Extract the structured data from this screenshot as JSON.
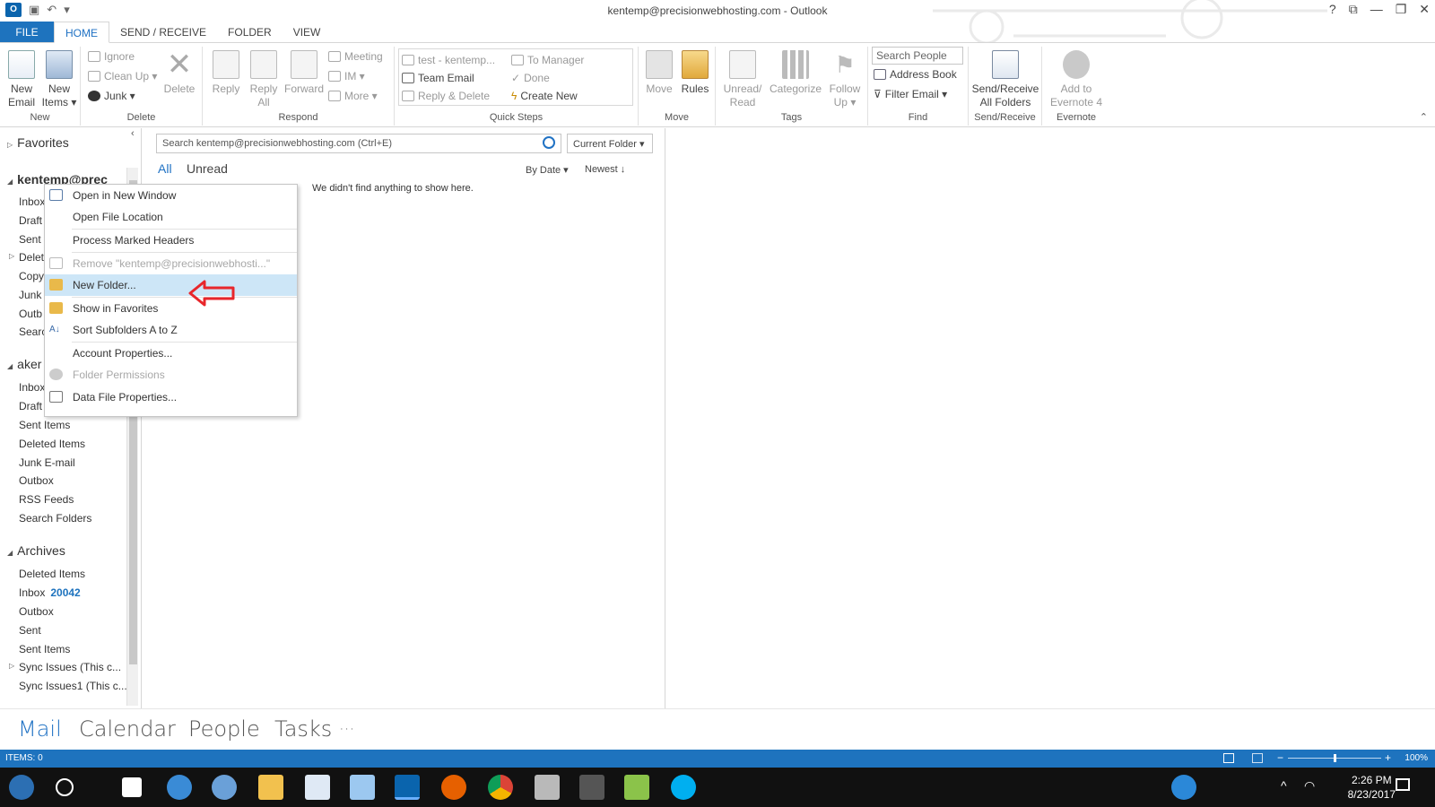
{
  "window": {
    "title": "kentemp@precisionwebhosting.com - Outlook",
    "controls": [
      "?",
      "⧉",
      "—",
      "❐",
      "✕"
    ]
  },
  "tabs": [
    "FILE",
    "HOME",
    "SEND / RECEIVE",
    "FOLDER",
    "VIEW"
  ],
  "ribbon": {
    "new": {
      "label": "New",
      "new_email": [
        "New",
        "Email"
      ],
      "new_items": [
        "New",
        "Items ▾"
      ]
    },
    "delete": {
      "label": "Delete",
      "ignore": "Ignore",
      "clean_up": "Clean Up ▾",
      "junk": "Junk ▾",
      "delete": "Delete"
    },
    "respond": {
      "label": "Respond",
      "reply": "Reply",
      "reply_all": [
        "Reply",
        "All"
      ],
      "forward": "Forward",
      "meeting": "Meeting",
      "im": "IM ▾",
      "more": "More ▾"
    },
    "quick_steps": {
      "label": "Quick Steps",
      "items": [
        "test - kentemp...",
        "To Manager",
        "Team Email",
        "Done",
        "Reply & Delete",
        "Create New"
      ]
    },
    "move": {
      "label": "Move",
      "move": "Move",
      "rules": "Rules"
    },
    "tags": {
      "label": "Tags",
      "unread_read": [
        "Unread/",
        "Read"
      ],
      "categorize": "Categorize",
      "follow_up": [
        "Follow",
        "Up ▾"
      ]
    },
    "find": {
      "label": "Find",
      "search_people": "Search People",
      "address_book": "Address Book",
      "filter_email": "Filter Email ▾"
    },
    "send_receive": {
      "label": "Send/Receive",
      "btn": [
        "Send/Receive",
        "All Folders"
      ]
    },
    "evernote": {
      "label": "Evernote",
      "btn": [
        "Add to",
        "Evernote 4"
      ]
    }
  },
  "nav": {
    "favorites": "Favorites",
    "account1": "kentemp@prec",
    "account1_items": [
      "Inbox",
      "Draft",
      "Sent",
      "Delet",
      "Copy",
      "Junk",
      "Outb",
      "Searc"
    ],
    "account2": "aker",
    "account2_items": [
      "Inbox",
      "Draft",
      "Sent Items",
      "Deleted Items",
      "Junk E-mail",
      "Outbox",
      "RSS Feeds",
      "Search Folders"
    ],
    "archives": "Archives",
    "archives_items": [
      "Deleted Items",
      "Inbox",
      "Outbox",
      "Sent",
      "Sent Items",
      "Sync Issues (This c...",
      "Sync Issues1 (This c..."
    ],
    "inbox_count": "20042"
  },
  "msglist": {
    "search_placeholder": "Search kentemp@precisionwebhosting.com (Ctrl+E)",
    "scope": "Current Folder",
    "filter_all": "All",
    "filter_unread": "Unread",
    "sort_by": "By Date ▾",
    "sort_order": "Newest ↓",
    "empty": "We didn't find anything to show here."
  },
  "context_menu": [
    "Open in New Window",
    "Open File Location",
    "Process Marked Headers",
    "Remove \"kentemp@precisionwebhosti...\"",
    "New Folder...",
    "Show in Favorites",
    "Sort Subfolders A to Z",
    "Account Properties...",
    "Folder Permissions",
    "Data File Properties..."
  ],
  "bottomnav": [
    "Mail",
    "Calendar",
    "People",
    "Tasks",
    "···"
  ],
  "status": {
    "items": "ITEMS: 0",
    "zoom": "100%"
  },
  "taskbar": {
    "time": "2:26 PM",
    "date": "8/23/2017"
  },
  "colors": {
    "accent": "#1e73be",
    "highlight": "#cde6f7",
    "arrow": "#e8262b"
  }
}
